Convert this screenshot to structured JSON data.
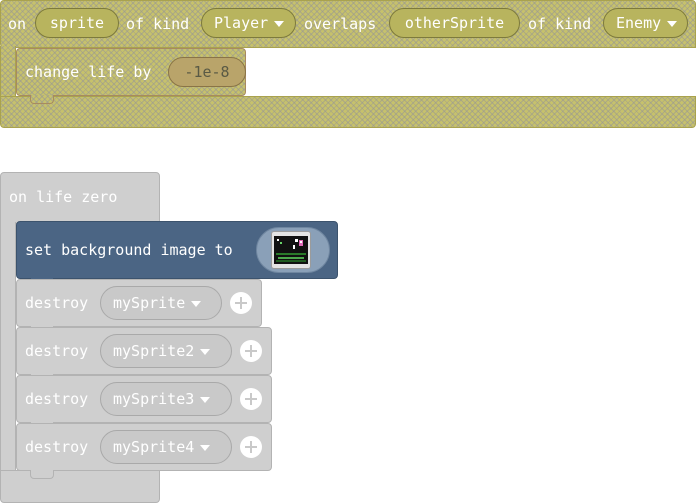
{
  "overlap_event": {
    "word_on": "on",
    "sprite_var": "sprite",
    "word_of_kind_1": "of kind",
    "kind_1": "Player",
    "word_overlaps": "overlaps",
    "other_sprite_var": "otherSprite",
    "word_of_kind_2": "of kind",
    "kind_2": "Enemy",
    "body": {
      "label": "change life by",
      "value": "-1e-8"
    }
  },
  "life_zero_event": {
    "title": "on life zero",
    "set_background": {
      "label": "set background image to",
      "thumbnail_icon": "background-image-thumbnail"
    },
    "destroy_blocks": [
      {
        "label": "destroy",
        "sprite": "mySprite"
      },
      {
        "label": "destroy",
        "sprite": "mySprite2"
      },
      {
        "label": "destroy",
        "sprite": "mySprite3"
      },
      {
        "label": "destroy",
        "sprite": "mySprite4"
      }
    ]
  },
  "colors": {
    "disabled_hatch": "#c6c16c",
    "scene_block": "#4b6584",
    "inactive_block": "#cfcfcf"
  }
}
